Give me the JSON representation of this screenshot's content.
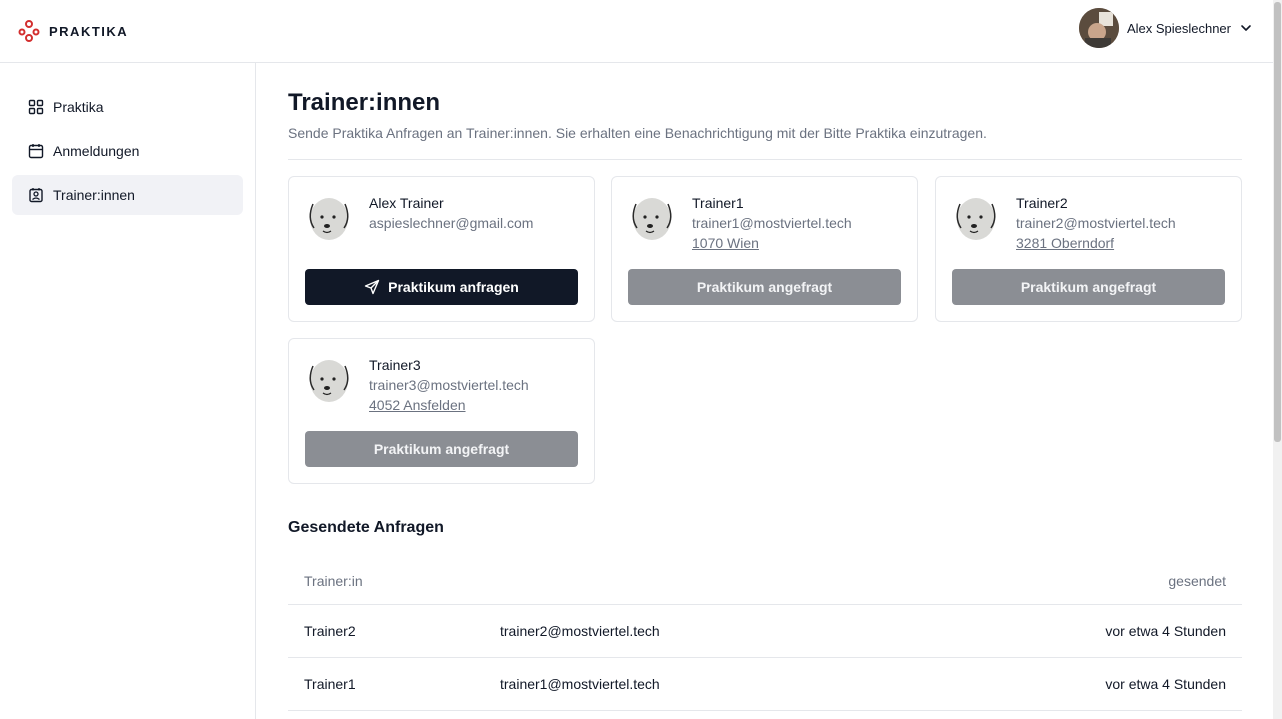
{
  "app": {
    "brand": "PRAKTIKA"
  },
  "user": {
    "name": "Alex Spieslechner"
  },
  "sidebar": {
    "items": [
      {
        "label": "Praktika",
        "icon": "grid-icon",
        "active": false
      },
      {
        "label": "Anmeldungen",
        "icon": "calendar-icon",
        "active": false
      },
      {
        "label": "Trainer:innen",
        "icon": "contact-icon",
        "active": true
      }
    ]
  },
  "page": {
    "title": "Trainer:innen",
    "subtitle": "Sende Praktika Anfragen an Trainer:innen. Sie erhalten eine Benachrichtigung mit der Bitte Praktika einzutragen."
  },
  "trainers": [
    {
      "name": "Alex Trainer",
      "email": "aspieslechner@gmail.com",
      "place": "",
      "button": "Praktikum anfragen",
      "requested": false
    },
    {
      "name": "Trainer1",
      "email": "trainer1@mostviertel.tech",
      "place": "1070 Wien",
      "button": "Praktikum angefragt",
      "requested": true
    },
    {
      "name": "Trainer2",
      "email": "trainer2@mostviertel.tech",
      "place": "3281 Oberndorf",
      "button": "Praktikum angefragt",
      "requested": true
    },
    {
      "name": "Trainer3",
      "email": "trainer3@mostviertel.tech",
      "place": "4052 Ansfelden",
      "button": "Praktikum angefragt",
      "requested": true
    }
  ],
  "requests": {
    "title": "Gesendete Anfragen",
    "headers": {
      "trainer": "Trainer:in",
      "sent": "gesendet"
    },
    "rows": [
      {
        "name": "Trainer2",
        "email": "trainer2@mostviertel.tech",
        "sent": "vor etwa 4 Stunden"
      },
      {
        "name": "Trainer1",
        "email": "trainer1@mostviertel.tech",
        "sent": "vor etwa 4 Stunden"
      }
    ]
  },
  "colors": {
    "primary": "#111827",
    "disabled": "#8b8e94",
    "brand": "#d32f2f"
  }
}
